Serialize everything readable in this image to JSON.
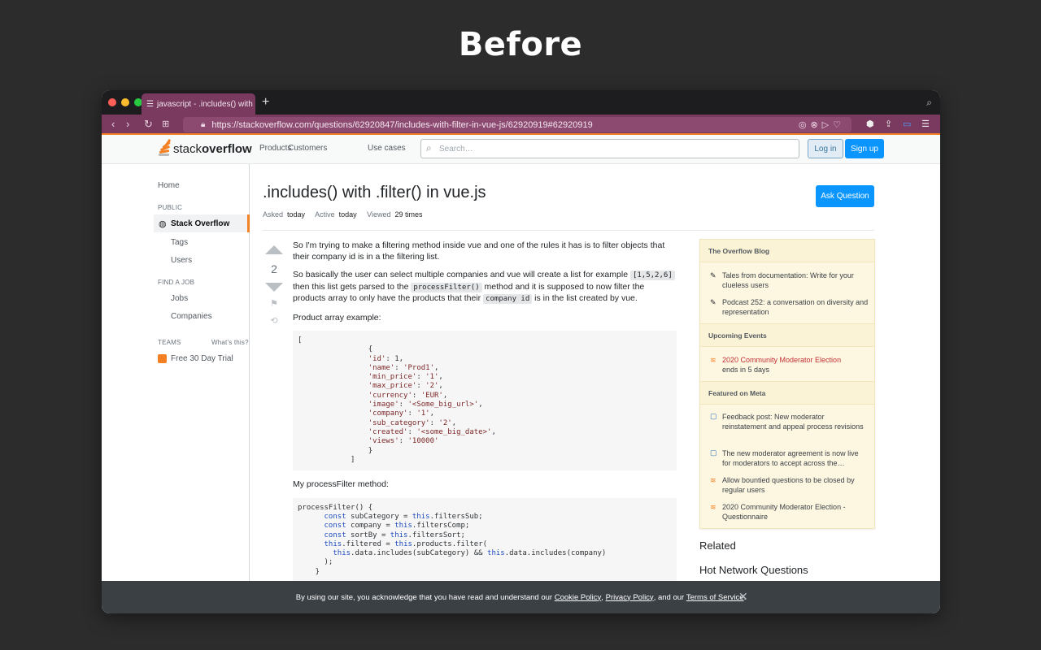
{
  "hero": {
    "title": "Before"
  },
  "browser": {
    "tab_title": "javascript - .includes() with .fil",
    "url": "https://stackoverflow.com/questions/62920847/includes-with-filter-in-vue-js/62920919#62920919"
  },
  "so_header": {
    "logo_light": "stack",
    "logo_bold": "overflow",
    "nav": [
      "Products",
      "Customers",
      "Use cases"
    ],
    "search_placeholder": "Search…",
    "login": "Log in",
    "signup": "Sign up"
  },
  "leftnav": {
    "home": "Home",
    "public": "PUBLIC",
    "stack_overflow": "Stack Overflow",
    "tags": "Tags",
    "users": "Users",
    "find_a_job": "FIND A JOB",
    "jobs": "Jobs",
    "companies": "Companies",
    "teams": "TEAMS",
    "whats_this": "What's this?",
    "free_trial": "Free 30 Day Trial"
  },
  "question": {
    "title": ".includes() with .filter() in vue.js",
    "asked_label": "Asked",
    "asked_value": "today",
    "active_label": "Active",
    "active_value": "today",
    "viewed_label": "Viewed",
    "viewed_value": "29 times",
    "ask_button": "Ask Question",
    "votes": "2",
    "para1": "So I'm trying to make a filtering method inside vue and one of the rules it has is to filter objects that their company id is in a the filtering list.",
    "para2_a": "So basically the user can select multiple companies and vue will create a list for example",
    "code_list": "[1,5,2,6]",
    "para2_b": "then this list gets parsed to the",
    "code_method": "processFilter()",
    "para2_c": "method and it is supposed to now filter the products array to only have the products that their",
    "code_company_id": "company id",
    "para2_d": "is in the list created by vue.",
    "product_label": "Product array example:",
    "method_label": "My processFilter method:"
  },
  "sidebar": {
    "blog_header": "The Overflow Blog",
    "blog_items": [
      "Tales from documentation: Write for your clueless users",
      "Podcast 252: a conversation on diversity and representation"
    ],
    "events_header": "Upcoming Events",
    "event_title": "2020 Community Moderator Election",
    "event_sub": "ends in 5 days",
    "meta_header": "Featured on Meta",
    "meta_items": [
      "Feedback post: New moderator reinstatement and appeal process revisions",
      "The new moderator agreement is now live for moderators to accept across the…",
      "Allow bountied questions to be closed by regular users",
      "2020 Community Moderator Election - Questionnaire"
    ],
    "related": "Related",
    "hot": "Hot Network Questions"
  },
  "cookie": {
    "text": "By using our site, you acknowledge that you have read and understand our",
    "cookie_policy": "Cookie Policy",
    "privacy_policy": "Privacy Policy",
    "and_our": ", and our",
    "terms": "Terms of Service"
  }
}
